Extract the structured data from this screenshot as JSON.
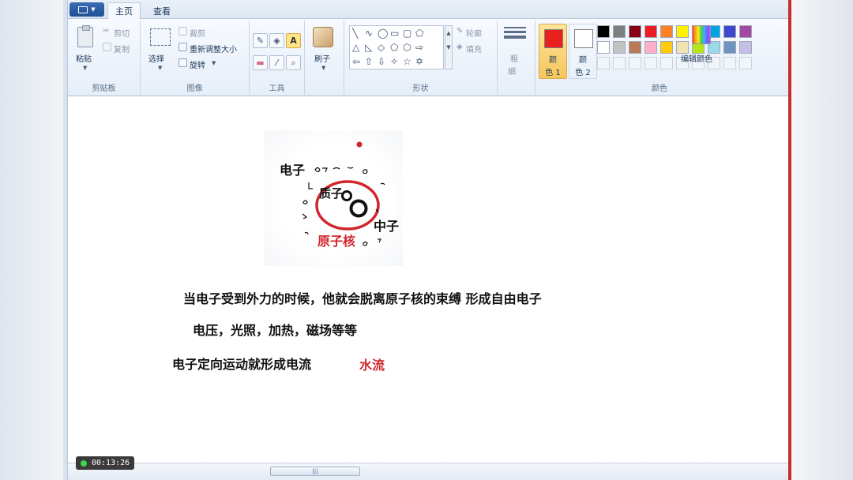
{
  "tabs": {
    "home": "主页",
    "view": "查看"
  },
  "ribbon": {
    "clipboard": {
      "label": "剪贴板",
      "paste": "粘贴",
      "cut": "剪切",
      "copy": "复制"
    },
    "image": {
      "label": "图像",
      "select": "选择",
      "crop": "裁剪",
      "resize": "重新调整大小",
      "rotate": "旋转"
    },
    "tools": {
      "label": "工具"
    },
    "brushes": {
      "label": "刷子"
    },
    "shapes": {
      "label": "形状",
      "outline": "轮廓",
      "fill": "填充"
    },
    "size": {
      "line1": "粗",
      "line2": "细"
    },
    "colors": {
      "label": "颜色",
      "color1": "颜\n色 1",
      "color1_a": "颜",
      "color1_b": "色 1",
      "color2_a": "颜",
      "color2_b": "色 2",
      "color1_value": "#e8201e",
      "color2_value": "#ffffff",
      "edit": "编辑颜色",
      "palette_row1": [
        "#000000",
        "#7f7f7f",
        "#880015",
        "#ed1c24",
        "#ff7f27",
        "#fff200",
        "#22b14c",
        "#00a2e8",
        "#3f48cc",
        "#a349a4"
      ],
      "palette_row2": [
        "#ffffff",
        "#c3c3c3",
        "#b97a57",
        "#ffaec9",
        "#ffc90e",
        "#efe4b0",
        "#b5e61d",
        "#99d9ea",
        "#7092be",
        "#c8bfe7"
      ]
    }
  },
  "canvas": {
    "diagram": {
      "electron": "电子",
      "proton": "质子",
      "neutron": "中子",
      "nucleus": "原子核"
    },
    "line1": "当电子受到外力的时候，他就会脱离原子核的束缚  形成自由电子",
    "line2": "电压，光照，加热，磁场等等",
    "line3": "电子定向运动就形成电流",
    "line3_red": "水流",
    "text_color": "#111111",
    "accent_red": "#d1262c"
  },
  "status": {
    "timer": "00:13:26"
  }
}
